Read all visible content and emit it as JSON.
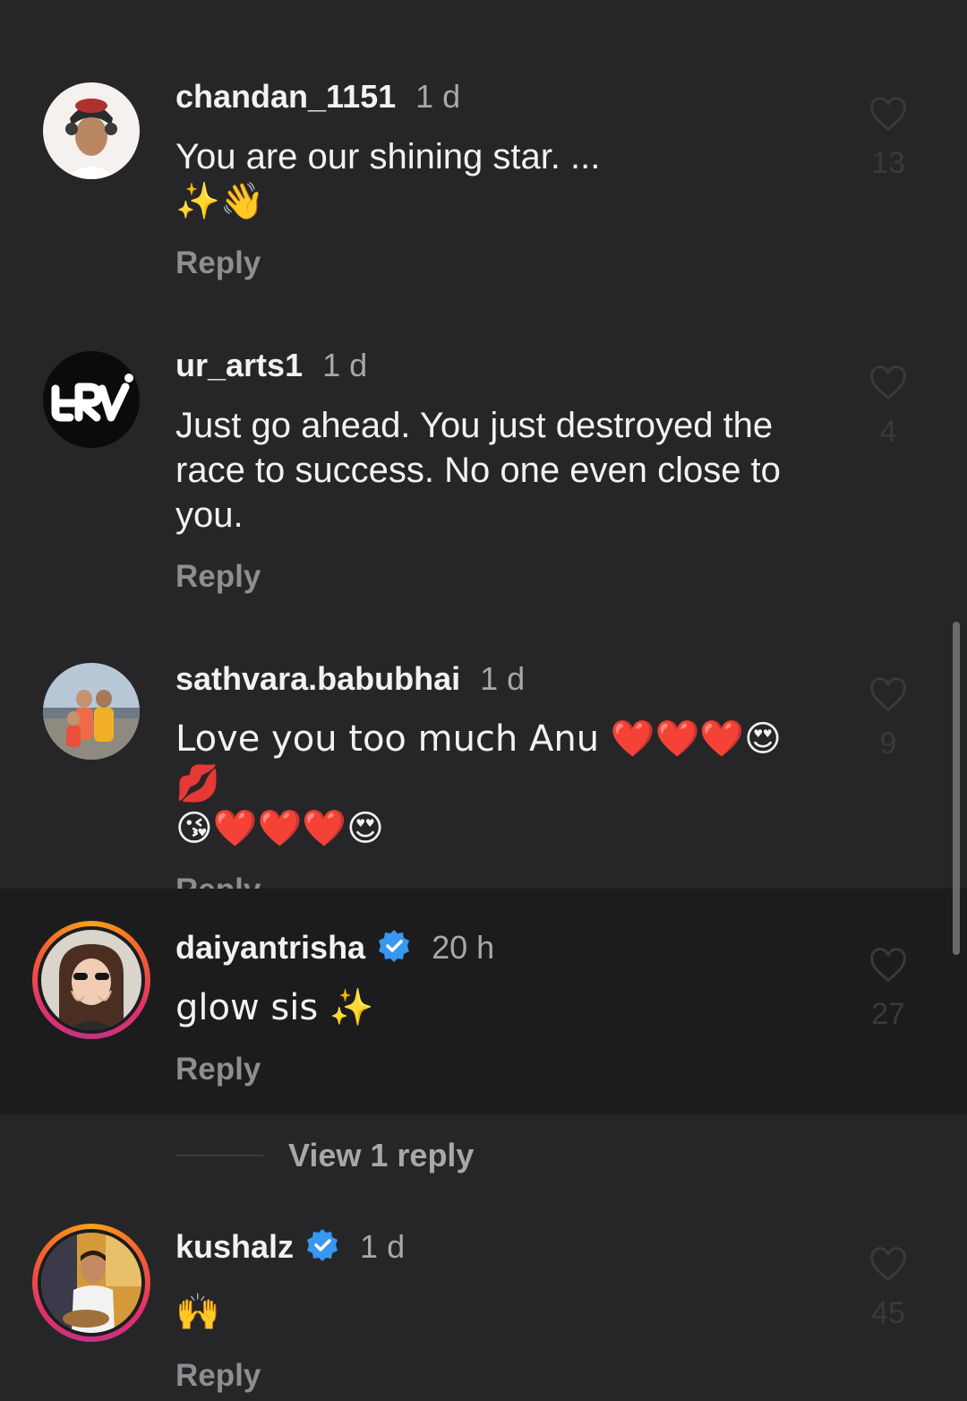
{
  "comments": [
    {
      "username": "chandan_1151",
      "time": "1 d",
      "text_line1": "You are our shining star. ...",
      "text_line2": "✨👋",
      "reply": "Reply",
      "likes": "13"
    },
    {
      "username": "ur_arts1",
      "time": "1 d",
      "text_line1": "Just go ahead. You just destroyed the",
      "text_line2": "race to success. No one even close to",
      "text_line3": "you.",
      "reply": "Reply",
      "likes": "4"
    },
    {
      "username": "sathvara.babubhai",
      "time": "1 d",
      "text_line1": "Love you too much Anu ❤️❤️❤️😍💋",
      "text_line2": "😘❤️❤️❤️😍",
      "reply": "Reply",
      "likes": "9"
    },
    {
      "username": "daiyantrisha",
      "time": "20 h",
      "text_line1": "glow sis ✨",
      "reply": "Reply",
      "likes": "27"
    },
    {
      "username": "kushalz",
      "time": "1 d",
      "text_line1": "🙌",
      "reply": "Reply",
      "likes": "45"
    }
  ],
  "view_replies": "View 1 reply",
  "colors": {
    "background": "#262628",
    "highlight": "#1c1c1e",
    "verified": "#3897f0"
  }
}
